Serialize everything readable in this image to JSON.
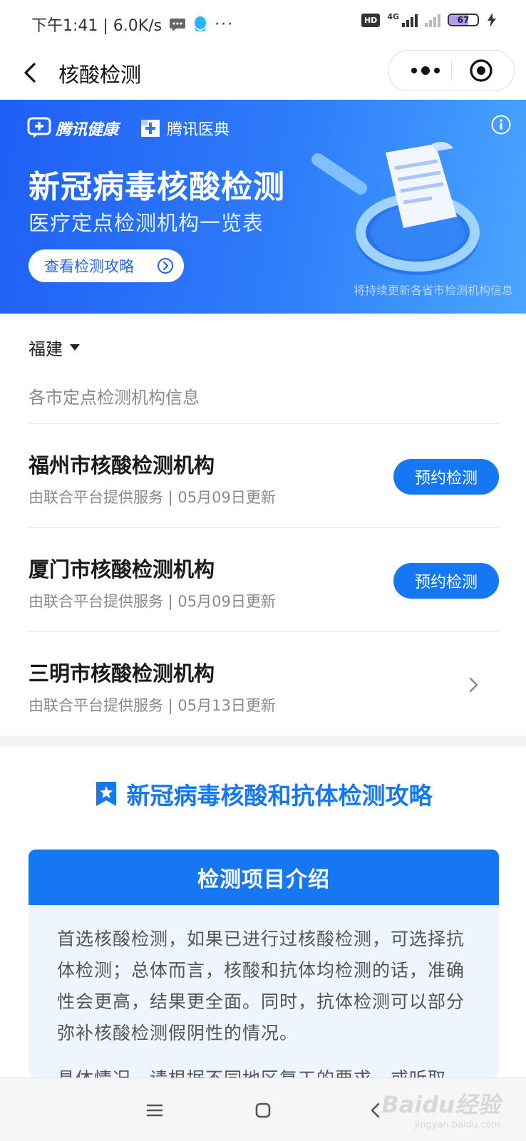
{
  "status_bar": {
    "time_speed": "下午1:41 | 6.0K/s",
    "hd": "HD",
    "network": "4G",
    "battery": "67",
    "battery_level": 0.67
  },
  "nav": {
    "title": "核酸检测",
    "icons": [
      "back-icon",
      "more-icon",
      "close-miniprogram-icon"
    ]
  },
  "banner": {
    "logo1": "腾讯健康",
    "logo2": "腾讯医典",
    "title": "新冠病毒核酸检测",
    "subtitle": "医疗定点检测机构一览表",
    "button": "查看检测攻略",
    "note": "将持续更新各省市检测机构信息",
    "colors": {
      "start": "#1e5ff5",
      "end": "#49a6ff"
    }
  },
  "province": {
    "selected": "福建"
  },
  "list": {
    "caption": "各市定点检测机构信息",
    "items": [
      {
        "name": "福州市核酸检测机构",
        "meta": "由联合平台提供服务 | 05月09日更新",
        "action": "预约检测"
      },
      {
        "name": "厦门市核酸检测机构",
        "meta": "由联合平台提供服务 | 05月09日更新",
        "action": "预约检测"
      },
      {
        "name": "三明市核酸检测机构",
        "meta": "由联合平台提供服务 | 05月13日更新",
        "action": ""
      }
    ]
  },
  "strategy": {
    "title": "新冠病毒核酸和抗体检测攻略",
    "card_title": "检测项目介绍",
    "paragraph1": "首选核酸检测，如果已进行过核酸检测，可选择抗体检测；总体而言，核酸和抗体均检测的话，准确性会更高，结果更全面。同时，抗体检测可以部分弥补核酸检测假阴性的情况。",
    "paragraph2": "具体情况，请根据不同地区复工的要求，或听取"
  },
  "system_nav": {
    "icons": [
      "menu-icon",
      "home-icon",
      "back-nav-icon"
    ]
  },
  "watermark": {
    "main": "Baidu经验",
    "sub": "jingyan.baidu.com"
  },
  "accent_color": "#1677f2"
}
